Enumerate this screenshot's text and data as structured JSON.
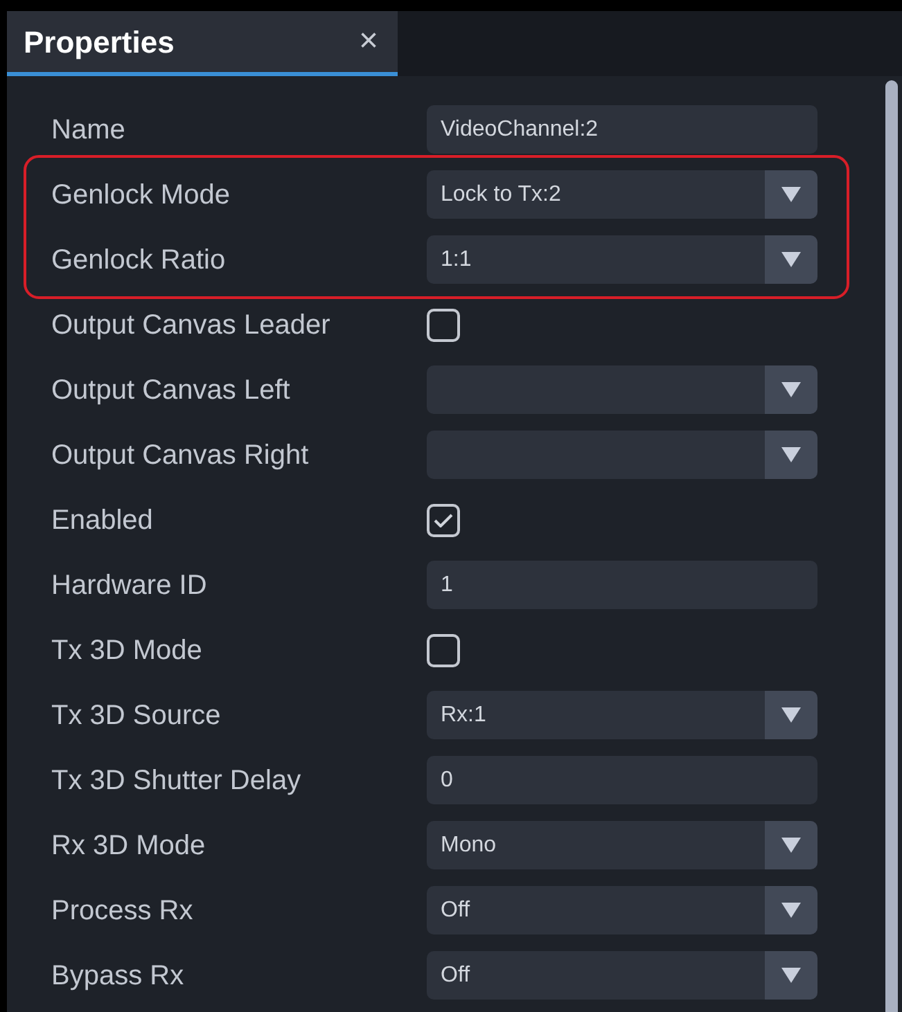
{
  "tab": {
    "label": "Properties",
    "selected": true,
    "close": "×"
  },
  "rows": [
    {
      "label": "Name",
      "kind": "text",
      "value": "VideoChannel:2",
      "highlighted": false
    },
    {
      "label": "Genlock Mode",
      "kind": "dropdown",
      "value": "Lock to Tx:2",
      "highlighted": true
    },
    {
      "label": "Genlock Ratio",
      "kind": "dropdown",
      "value": "1:1",
      "highlighted": true
    },
    {
      "label": "Output Canvas Leader",
      "kind": "checkbox",
      "checked": false,
      "highlighted": false
    },
    {
      "label": "Output Canvas Left",
      "kind": "dropdown",
      "highlighted": false
    },
    {
      "label": "Output Canvas Right",
      "kind": "dropdown",
      "highlighted": false
    },
    {
      "label": "Enabled",
      "kind": "checkbox",
      "checked": true,
      "highlighted": false
    },
    {
      "label": "Hardware ID",
      "kind": "text",
      "value": "1",
      "highlighted": false
    },
    {
      "label": "Tx 3D Mode",
      "kind": "checkbox",
      "checked": false,
      "highlighted": false
    },
    {
      "label": "Tx 3D Source",
      "kind": "dropdown",
      "value": "Rx:1",
      "highlighted": false
    },
    {
      "label": "Tx 3D Shutter Delay",
      "kind": "text",
      "value": "0",
      "highlighted": false
    },
    {
      "label": "Rx 3D Mode",
      "kind": "dropdown",
      "value": "Mono",
      "highlighted": false
    },
    {
      "label": "Process Rx",
      "kind": "dropdown",
      "value": "Off",
      "highlighted": false
    },
    {
      "label": "Bypass Rx",
      "kind": "dropdown",
      "value": "Off",
      "highlighted": false
    }
  ]
}
